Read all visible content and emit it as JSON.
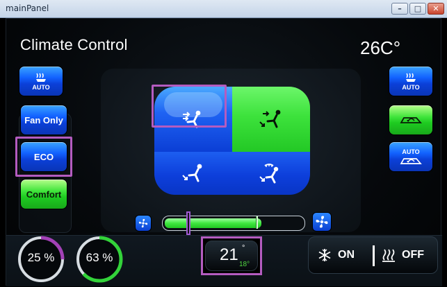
{
  "window": {
    "title": "mainPanel",
    "buttons": {
      "minimize": "–",
      "maximize": "□",
      "close": "✕"
    }
  },
  "header": {
    "title": "Climate Control",
    "outside_temp": "26C°"
  },
  "left_controls": [
    {
      "name": "seat-heat-auto",
      "label": "AUTO",
      "icon": "seat-heat-icon",
      "style": "blue"
    },
    {
      "name": "fan-only",
      "label": "Fan Only",
      "style": "blue"
    },
    {
      "name": "eco",
      "label": "ECO",
      "style": "blue",
      "selected": true
    },
    {
      "name": "comfort",
      "label": "Comfort",
      "style": "green"
    }
  ],
  "right_controls": [
    {
      "name": "seat-heat-auto-right",
      "label": "AUTO",
      "icon": "seat-heat-icon",
      "style": "blue"
    },
    {
      "name": "recirculation",
      "icon": "recirculation-car-icon",
      "style": "green"
    },
    {
      "name": "auto-recirculation",
      "label": "AUTO",
      "icon": "recirculation-car-icon",
      "style": "blue"
    }
  ],
  "airflow": {
    "modes": [
      {
        "name": "face",
        "icon": "vent-face-icon",
        "active": true
      },
      {
        "name": "face-and-feet",
        "icon": "vent-face-feet-icon",
        "active": true
      },
      {
        "name": "feet",
        "icon": "vent-feet-icon",
        "active": false
      },
      {
        "name": "feet-and-defrost",
        "icon": "vent-defrost-feet-icon",
        "active": false
      }
    ]
  },
  "fan": {
    "level_fraction": 0.7,
    "marker_fraction": 0.66,
    "thumb_fraction": 0.17,
    "minus_icon": "fan-small-icon",
    "plus_icon": "fan-large-icon"
  },
  "gauges": [
    {
      "name": "gauge-1",
      "value": 25,
      "label": "25 %",
      "color": "#a241b6"
    },
    {
      "name": "gauge-2",
      "value": 63,
      "label": "63 %",
      "color": "#33d33a"
    }
  ],
  "setpoint": {
    "value": "21",
    "unit": "°",
    "sub_value": "18",
    "sub_unit": "°"
  },
  "modes": {
    "ac_label": "ON",
    "ac_icon": "snowflake-icon",
    "heat_label": "OFF",
    "heat_icon": "rear-defrost-icon"
  },
  "colors": {
    "selection": "#b45cc0",
    "blue": "#1262ff",
    "green": "#3fe43b"
  }
}
